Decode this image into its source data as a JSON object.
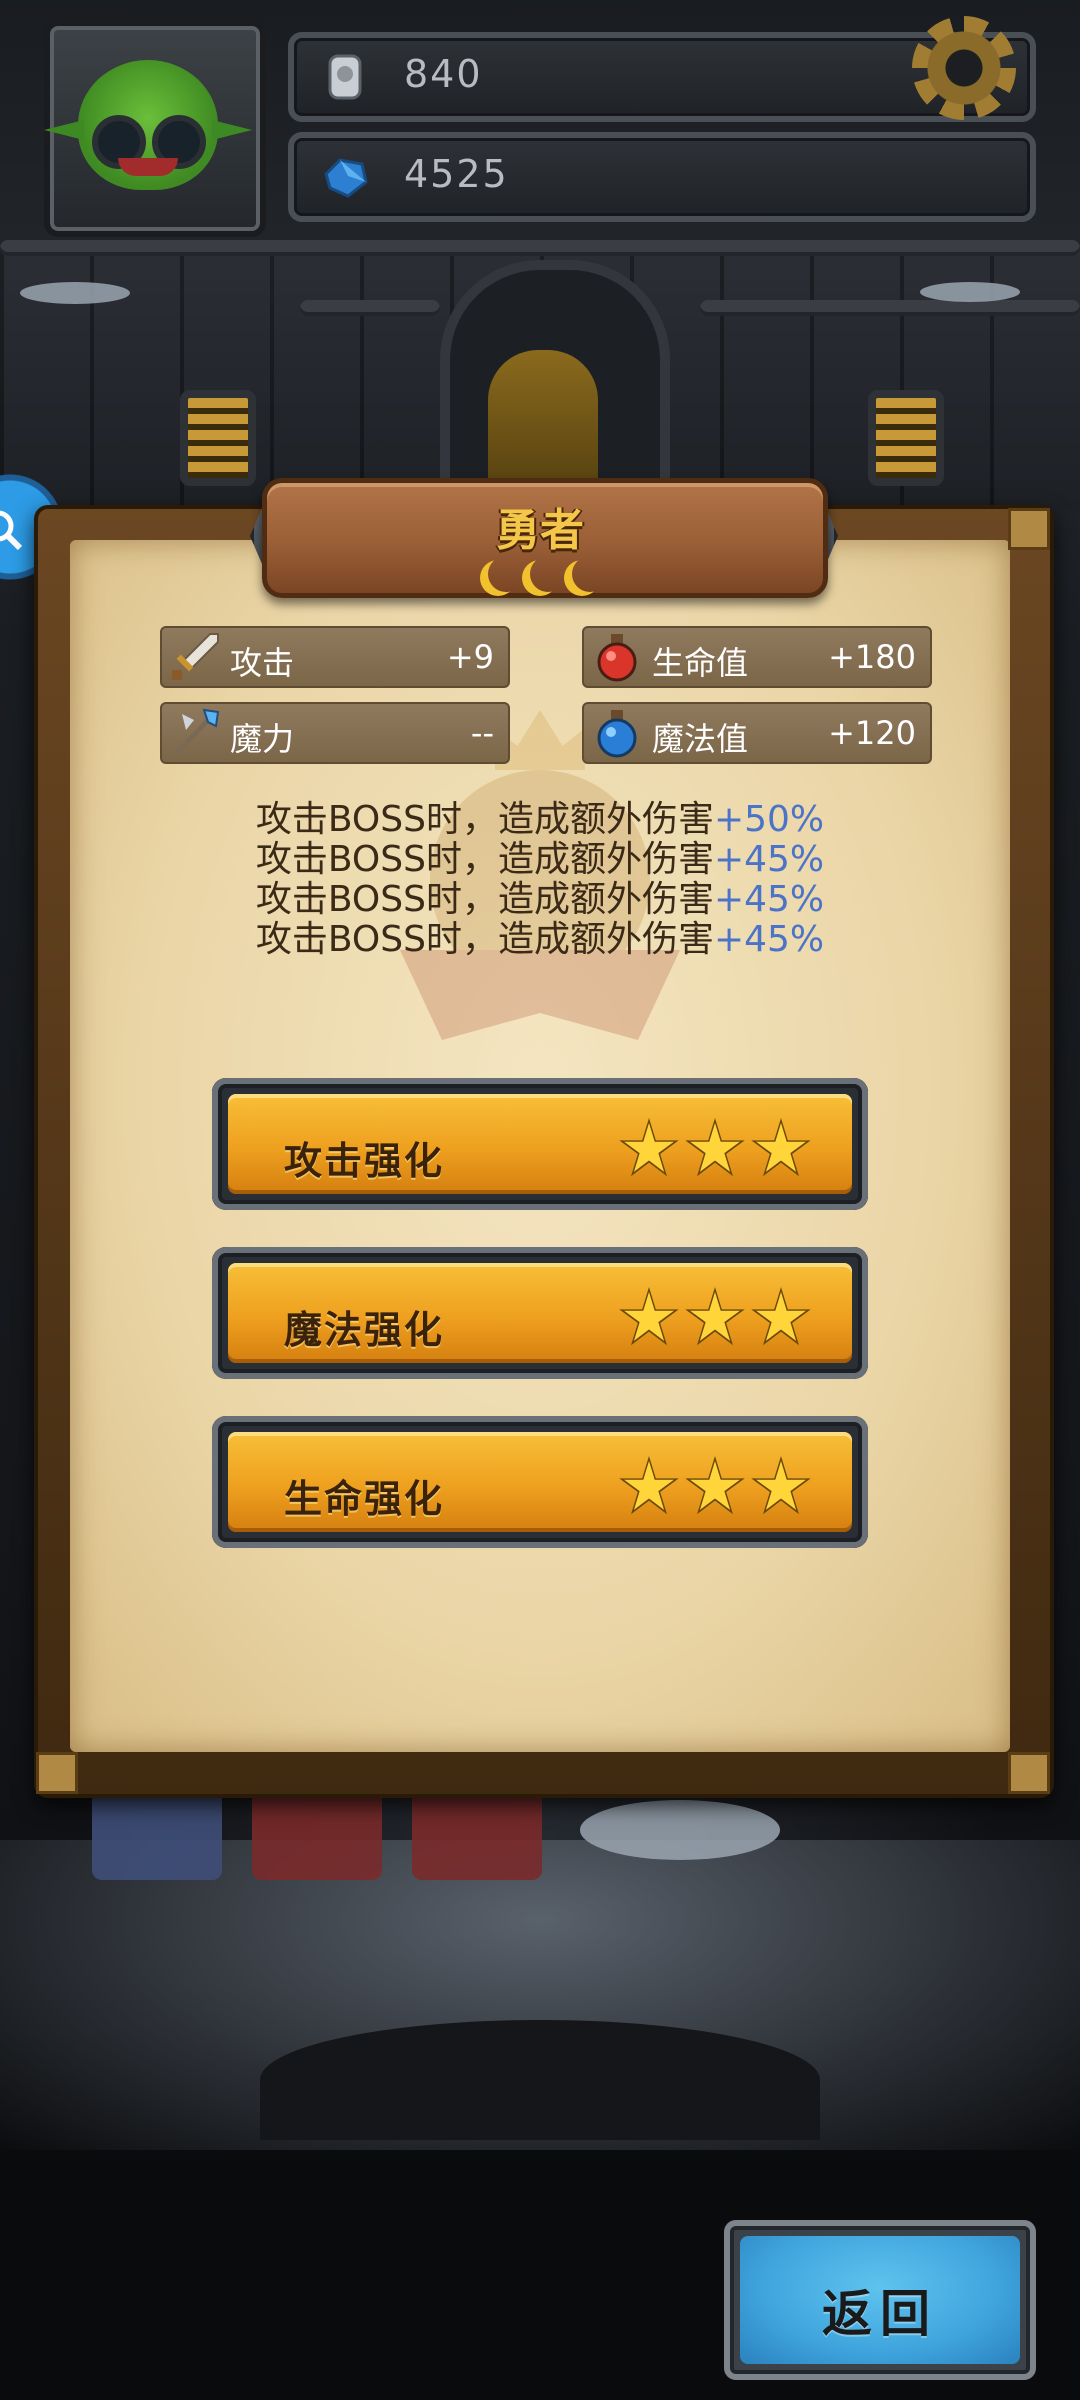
{
  "hud": {
    "silver_value": "840",
    "gem_value": "4525"
  },
  "panel": {
    "title": "勇者",
    "stats": [
      {
        "label": "攻击",
        "value": "+9",
        "icon": "sword-icon"
      },
      {
        "label": "生命值",
        "value": "+180",
        "icon": "red-potion-icon"
      },
      {
        "label": "魔力",
        "value": "--",
        "icon": "magic-staff-icon"
      },
      {
        "label": "魔法值",
        "value": "+120",
        "icon": "blue-potion-icon"
      }
    ],
    "bonus_lines": [
      {
        "text": "攻击BOSS时，造成额外伤害",
        "pct": "+50%"
      },
      {
        "text": "攻击BOSS时，造成额外伤害",
        "pct": "+45%"
      },
      {
        "text": "攻击BOSS时，造成额外伤害",
        "pct": "+45%"
      },
      {
        "text": "攻击BOSS时，造成额外伤害",
        "pct": "+45%"
      }
    ],
    "upgrades": [
      {
        "label": "攻击强化",
        "stars": 3
      },
      {
        "label": "魔法强化",
        "stars": 3
      },
      {
        "label": "生命强化",
        "stars": 3
      }
    ]
  },
  "back_button": {
    "label": "返回"
  },
  "colors": {
    "title_gold": "#f4c64a",
    "bonus_blue": "#4b74c8",
    "button_orange": "#eea01f",
    "back_blue": "#3fa4dc"
  }
}
